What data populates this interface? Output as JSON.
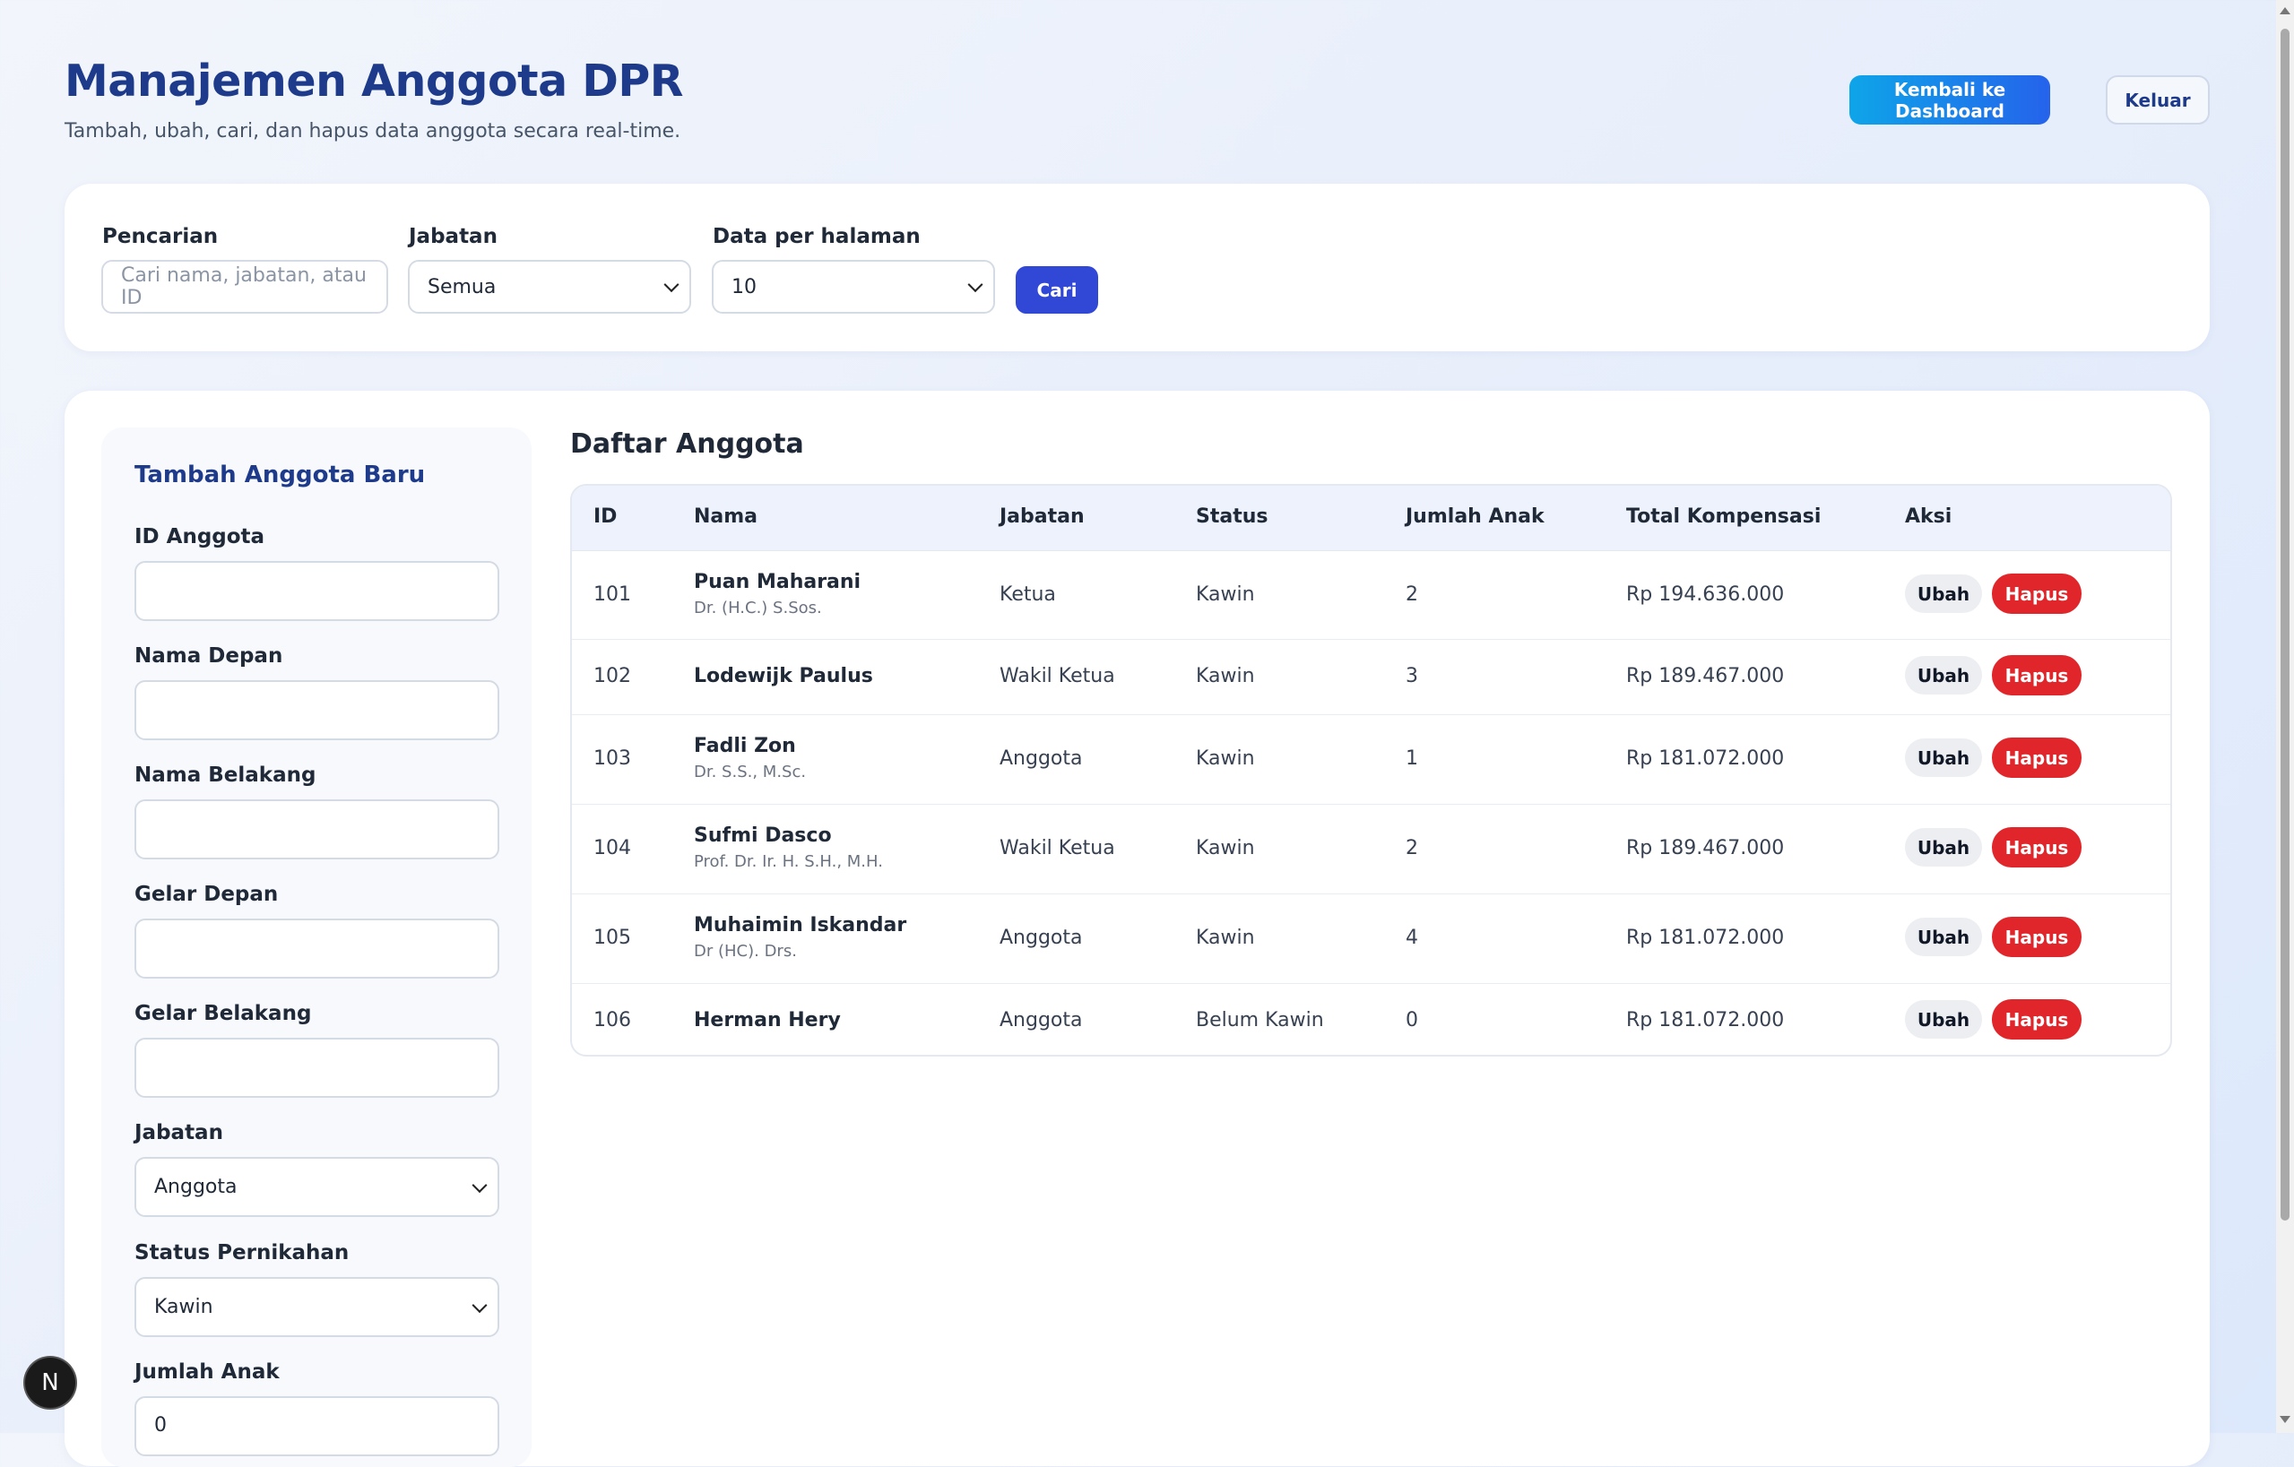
{
  "header": {
    "title": "Manajemen Anggota DPR",
    "subtitle": "Tambah, ubah, cari, dan hapus data anggota secara real-time.",
    "dashboard_button": "Kembali ke Dashboard",
    "logout_button": "Keluar"
  },
  "filters": {
    "search_label": "Pencarian",
    "search_placeholder": "Cari nama, jabatan, atau ID",
    "position_label": "Jabatan",
    "position_value": "Semua",
    "per_page_label": "Data per halaman",
    "per_page_value": "10",
    "search_button": "Cari"
  },
  "form": {
    "title": "Tambah Anggota Baru",
    "fields": {
      "id_label": "ID Anggota",
      "first_name_label": "Nama Depan",
      "last_name_label": "Nama Belakang",
      "front_title_label": "Gelar Depan",
      "back_title_label": "Gelar Belakang",
      "position_label": "Jabatan",
      "position_value": "Anggota",
      "marital_label": "Status Pernikahan",
      "marital_value": "Kawin",
      "children_label": "Jumlah Anak",
      "children_value": "0"
    }
  },
  "table": {
    "title": "Daftar Anggota",
    "headers": [
      "ID",
      "Nama",
      "Jabatan",
      "Status",
      "Jumlah Anak",
      "Total Kompensasi",
      "Aksi"
    ],
    "edit_label": "Ubah",
    "delete_label": "Hapus",
    "rows": [
      {
        "id": "101",
        "name": "Puan Maharani",
        "title": "Dr. (H.C.) S.Sos.",
        "position": "Ketua",
        "status": "Kawin",
        "children": "2",
        "compensation": "Rp 194.636.000"
      },
      {
        "id": "102",
        "name": "Lodewijk Paulus",
        "title": "",
        "position": "Wakil Ketua",
        "status": "Kawin",
        "children": "3",
        "compensation": "Rp 189.467.000"
      },
      {
        "id": "103",
        "name": "Fadli Zon",
        "title": "Dr. S.S., M.Sc.",
        "position": "Anggota",
        "status": "Kawin",
        "children": "1",
        "compensation": "Rp 181.072.000"
      },
      {
        "id": "104",
        "name": "Sufmi Dasco",
        "title": "Prof. Dr. Ir. H. S.H., M.H.",
        "position": "Wakil Ketua",
        "status": "Kawin",
        "children": "2",
        "compensation": "Rp 189.467.000"
      },
      {
        "id": "105",
        "name": "Muhaimin Iskandar",
        "title": "Dr (HC). Drs.",
        "position": "Anggota",
        "status": "Kawin",
        "children": "4",
        "compensation": "Rp 181.072.000"
      },
      {
        "id": "106",
        "name": "Herman Hery",
        "title": "",
        "position": "Anggota",
        "status": "Belum Kawin",
        "children": "0",
        "compensation": "Rp 181.072.000"
      }
    ]
  },
  "badge": {
    "letter": "N"
  }
}
